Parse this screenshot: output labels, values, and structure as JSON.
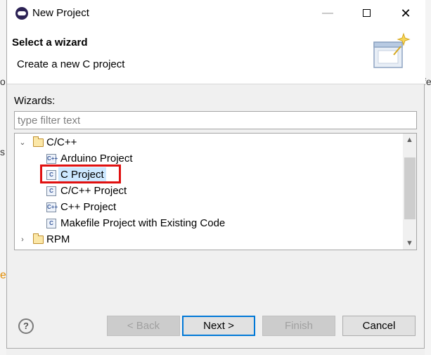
{
  "window": {
    "title": "New Project",
    "minimize_glyph": "—",
    "close_glyph": "✕"
  },
  "header": {
    "title": "Select a wizard",
    "description": "Create a new C project"
  },
  "wizards": {
    "label": "Wizards:",
    "filter_placeholder": "type filter text"
  },
  "tree": {
    "category": {
      "label": "C/C++",
      "expanded": true,
      "twisty": "⌄"
    },
    "items": [
      {
        "label": "Arduino Project",
        "icon": "c-project-icon",
        "icon_text": "C++"
      },
      {
        "label": "C Project",
        "icon": "c-project-icon",
        "icon_text": "C",
        "selected": true
      },
      {
        "label": "C/C++ Project",
        "icon": "c-project-icon",
        "icon_text": "C"
      },
      {
        "label": "C++ Project",
        "icon": "c-project-icon",
        "icon_text": "C++"
      },
      {
        "label": "Makefile Project with Existing Code",
        "icon": "c-project-icon",
        "icon_text": "C"
      }
    ],
    "collapsed_category": {
      "label": "RPM",
      "expanded": false,
      "twisty": "›"
    }
  },
  "buttons": {
    "help": "?",
    "back": "< Back",
    "next": "Next >",
    "finish": "Finish",
    "cancel": "Cancel"
  },
  "background_fragments": {
    "left_o": "o",
    "right_fe": "fe",
    "left_s": "s",
    "left_e": "e"
  },
  "colors": {
    "selection": "#cde8ff",
    "highlight_box": "#e01010",
    "default_button_border": "#0078d7"
  }
}
